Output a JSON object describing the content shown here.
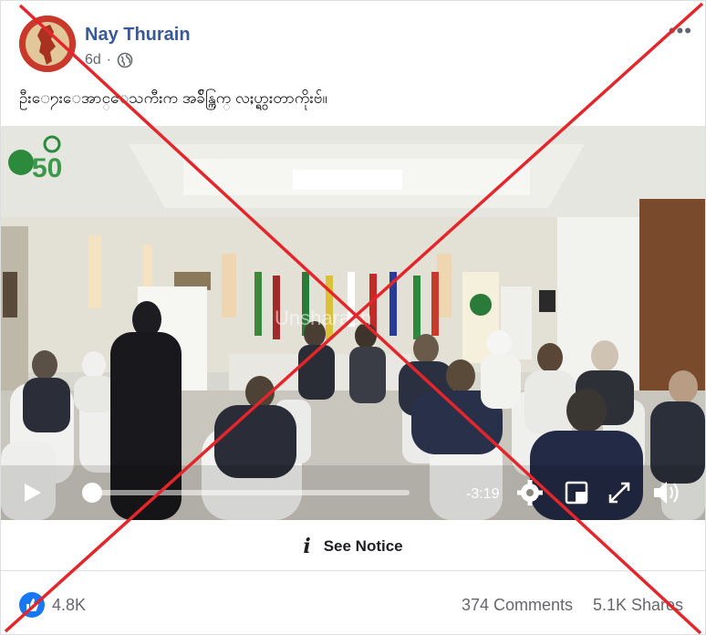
{
  "post": {
    "author": "Nay Thurain",
    "time": "6d",
    "more_label": "•••",
    "caption": "ဦးေ႒းေအာင္ေသကီးက အခ်ိန္ကြက္ လႈပ္ရွားတာကိုးဗ်။"
  },
  "video": {
    "watermark": "Unsharash",
    "logo_number": "50",
    "time_remaining": "-3:19",
    "progress": 0.0
  },
  "notice": {
    "icon": "info-icon",
    "label": "See Notice"
  },
  "stats": {
    "likes": "4.8K",
    "comments": "374 Comments",
    "shares": "5.1K Shares"
  },
  "colors": {
    "author": "#385898",
    "cross": "#e4262b",
    "like": "#1877f2"
  }
}
